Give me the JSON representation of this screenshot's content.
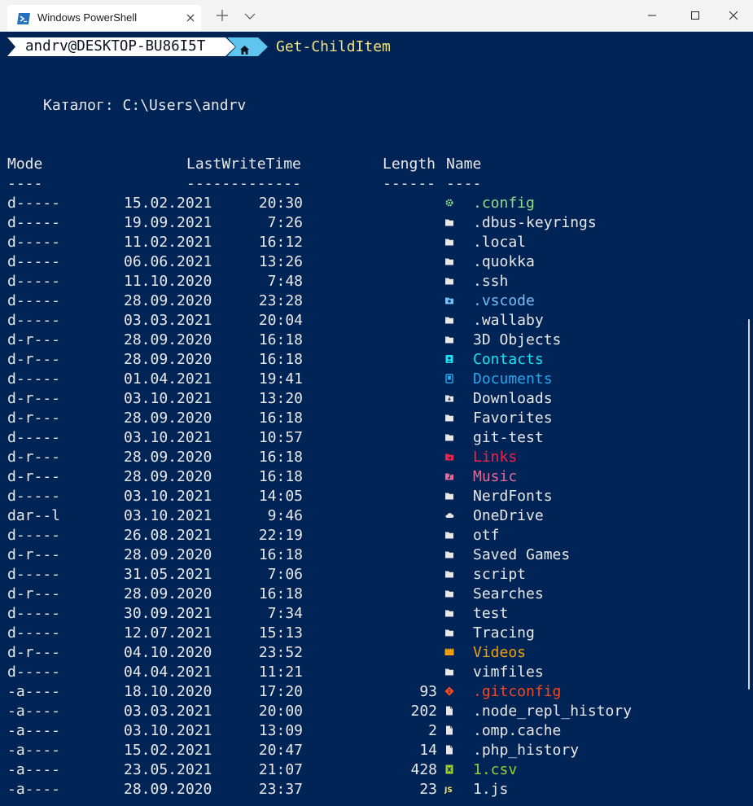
{
  "window": {
    "tab_title": "Windows PowerShell"
  },
  "colors": {
    "background": "#012456",
    "text": "#e8e8e8",
    "command": "#f5e37c",
    "prompt_user_bg": "#ffffff",
    "prompt_path_bg": "#5fc4ee"
  },
  "prompt": {
    "user": "andrv@DESKTOP-BU86I5T",
    "path_icon": "home-icon",
    "command": "Get-ChildItem"
  },
  "directory": {
    "label": "Каталог: C:\\Users\\andrv"
  },
  "columns": {
    "mode": "Mode",
    "lastwritetime": "LastWriteTime",
    "length": "Length",
    "name": "Name",
    "mode_sep": "----",
    "lastwritetime_sep": "-------------",
    "length_sep": "------",
    "name_sep": "----"
  },
  "rows": [
    {
      "mode": "d-----",
      "date": "15.02.2021",
      "time": "20:30",
      "length": "",
      "name": ".config",
      "icon": "gear-icon",
      "color": "#8fdc8c"
    },
    {
      "mode": "d-----",
      "date": "19.09.2021",
      "time": "7:26",
      "length": "",
      "name": ".dbus-keyrings",
      "icon": "folder-icon",
      "color": "#e8e8e8"
    },
    {
      "mode": "d-----",
      "date": "11.02.2021",
      "time": "16:12",
      "length": "",
      "name": ".local",
      "icon": "folder-icon",
      "color": "#e8e8e8"
    },
    {
      "mode": "d-----",
      "date": "06.06.2021",
      "time": "13:26",
      "length": "",
      "name": ".quokka",
      "icon": "folder-icon",
      "color": "#e8e8e8"
    },
    {
      "mode": "d-----",
      "date": "11.10.2020",
      "time": "7:48",
      "length": "",
      "name": ".ssh",
      "icon": "folder-icon",
      "color": "#e8e8e8"
    },
    {
      "mode": "d-----",
      "date": "28.09.2020",
      "time": "23:28",
      "length": "",
      "name": ".vscode",
      "icon": "vscode-folder-icon",
      "color": "#75bef8"
    },
    {
      "mode": "d-----",
      "date": "03.03.2021",
      "time": "20:04",
      "length": "",
      "name": ".wallaby",
      "icon": "folder-icon",
      "color": "#e8e8e8"
    },
    {
      "mode": "d-r---",
      "date": "28.09.2020",
      "time": "16:18",
      "length": "",
      "name": "3D Objects",
      "icon": "folder-icon",
      "color": "#e8e8e8"
    },
    {
      "mode": "d-r---",
      "date": "28.09.2020",
      "time": "16:18",
      "length": "",
      "name": "Contacts",
      "icon": "contacts-icon",
      "color": "#16e3f5"
    },
    {
      "mode": "d-----",
      "date": "01.04.2021",
      "time": "19:41",
      "length": "",
      "name": "Documents",
      "icon": "documents-icon",
      "color": "#1fa7f0"
    },
    {
      "mode": "d-r---",
      "date": "03.10.2021",
      "time": "13:20",
      "length": "",
      "name": "Downloads",
      "icon": "downloads-folder-icon",
      "color": "#e8e8e8"
    },
    {
      "mode": "d-r---",
      "date": "28.09.2020",
      "time": "16:18",
      "length": "",
      "name": "Favorites",
      "icon": "folder-icon",
      "color": "#e8e8e8"
    },
    {
      "mode": "d-----",
      "date": "03.10.2021",
      "time": "10:57",
      "length": "",
      "name": "git-test",
      "icon": "folder-icon",
      "color": "#e8e8e8"
    },
    {
      "mode": "d-r---",
      "date": "28.09.2020",
      "time": "16:18",
      "length": "",
      "name": "Links",
      "icon": "links-folder-icon",
      "color": "#f0224a"
    },
    {
      "mode": "d-r---",
      "date": "28.09.2020",
      "time": "16:18",
      "length": "",
      "name": "Music",
      "icon": "music-folder-icon",
      "color": "#e56a9a"
    },
    {
      "mode": "d-----",
      "date": "03.10.2021",
      "time": "14:05",
      "length": "",
      "name": "NerdFonts",
      "icon": "folder-icon",
      "color": "#e8e8e8"
    },
    {
      "mode": "dar--l",
      "date": "03.10.2021",
      "time": "9:46",
      "length": "",
      "name": "OneDrive",
      "icon": "cloud-icon",
      "color": "#e8e8e8"
    },
    {
      "mode": "d-----",
      "date": "26.08.2021",
      "time": "22:19",
      "length": "",
      "name": "otf",
      "icon": "folder-icon",
      "color": "#e8e8e8"
    },
    {
      "mode": "d-r---",
      "date": "28.09.2020",
      "time": "16:18",
      "length": "",
      "name": "Saved Games",
      "icon": "folder-icon",
      "color": "#e8e8e8"
    },
    {
      "mode": "d-----",
      "date": "31.05.2021",
      "time": "7:06",
      "length": "",
      "name": "script",
      "icon": "folder-icon",
      "color": "#e8e8e8"
    },
    {
      "mode": "d-r---",
      "date": "28.09.2020",
      "time": "16:18",
      "length": "",
      "name": "Searches",
      "icon": "folder-icon",
      "color": "#e8e8e8"
    },
    {
      "mode": "d-----",
      "date": "30.09.2021",
      "time": "7:34",
      "length": "",
      "name": "test",
      "icon": "folder-icon",
      "color": "#e8e8e8"
    },
    {
      "mode": "d-----",
      "date": "12.07.2021",
      "time": "15:13",
      "length": "",
      "name": "Tracing",
      "icon": "folder-icon",
      "color": "#e8e8e8"
    },
    {
      "mode": "d-r---",
      "date": "04.10.2020",
      "time": "23:52",
      "length": "",
      "name": "Videos",
      "icon": "videos-icon",
      "color": "#f0a00c"
    },
    {
      "mode": "d-----",
      "date": "04.04.2021",
      "time": "11:21",
      "length": "",
      "name": "vimfiles",
      "icon": "folder-icon",
      "color": "#e8e8e8"
    },
    {
      "mode": "-a----",
      "date": "18.10.2020",
      "time": "17:20",
      "length": "93",
      "name": ".gitconfig",
      "icon": "git-icon",
      "color": "#f5481c"
    },
    {
      "mode": "-a----",
      "date": "03.03.2021",
      "time": "20:00",
      "length": "202",
      "name": ".node_repl_history",
      "icon": "file-icon",
      "color": "#e8e8e8"
    },
    {
      "mode": "-a----",
      "date": "03.10.2021",
      "time": "13:09",
      "length": "2",
      "name": ".omp.cache",
      "icon": "file-icon",
      "color": "#e8e8e8"
    },
    {
      "mode": "-a----",
      "date": "15.02.2021",
      "time": "20:47",
      "length": "14",
      "name": ".php_history",
      "icon": "file-icon",
      "color": "#e8e8e8"
    },
    {
      "mode": "-a----",
      "date": "23.05.2021",
      "time": "21:07",
      "length": "428",
      "name": "1.csv",
      "icon": "csv-icon",
      "color": "#9acd32"
    },
    {
      "mode": "-a----",
      "date": "28.09.2020",
      "time": "23:37",
      "length": "23",
      "name": "1.js",
      "icon": "js-icon",
      "color": "#e8e8e8"
    }
  ]
}
